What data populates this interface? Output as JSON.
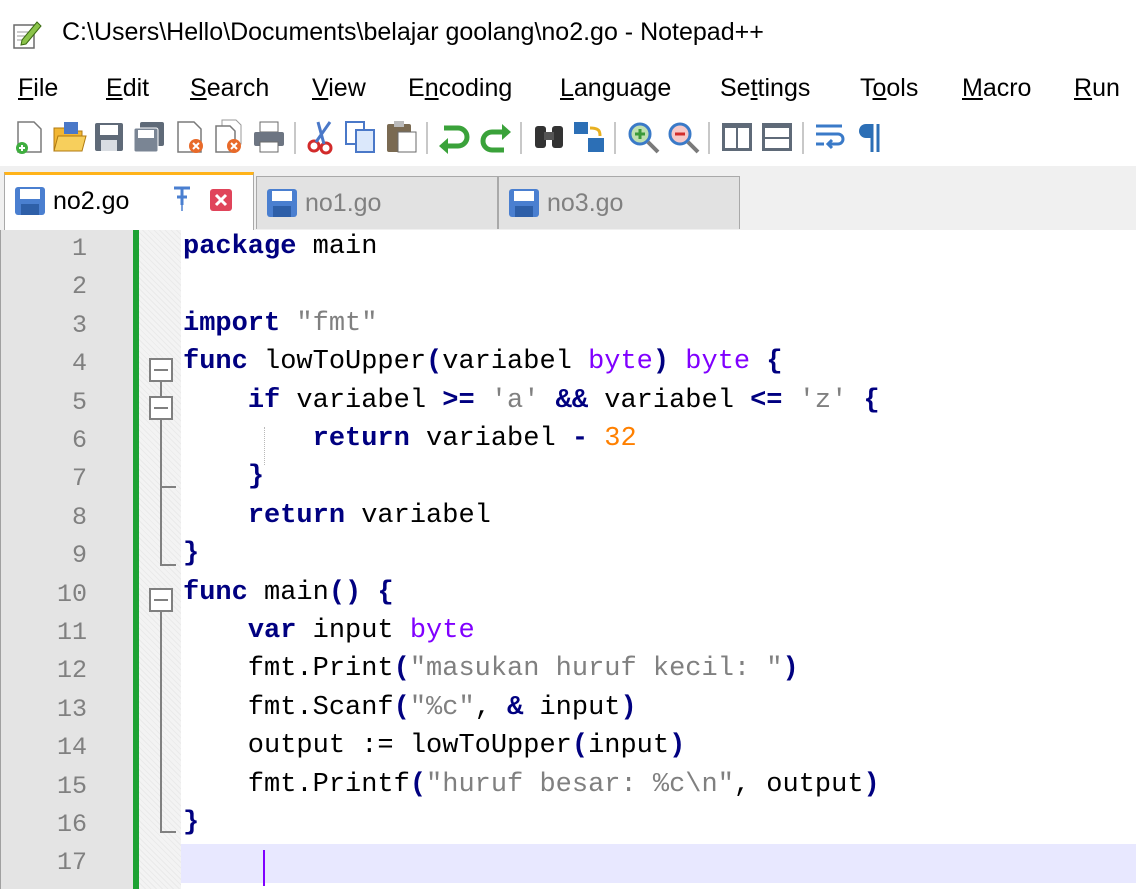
{
  "window": {
    "title": "C:\\Users\\Hello\\Documents\\belajar goolang\\no2.go - Notepad++"
  },
  "menu": [
    {
      "pre": "",
      "mn": "F",
      "post": "ile"
    },
    {
      "pre": "",
      "mn": "E",
      "post": "dit"
    },
    {
      "pre": "",
      "mn": "S",
      "post": "earch"
    },
    {
      "pre": "",
      "mn": "V",
      "post": "iew"
    },
    {
      "pre": "E",
      "mn": "n",
      "post": "coding"
    },
    {
      "pre": "",
      "mn": "L",
      "post": "anguage"
    },
    {
      "pre": "Se",
      "mn": "t",
      "post": "tings"
    },
    {
      "pre": "T",
      "mn": "o",
      "post": "ols"
    },
    {
      "pre": "",
      "mn": "M",
      "post": "acro"
    },
    {
      "pre": "",
      "mn": "R",
      "post": "un"
    }
  ],
  "toolbar_icons": [
    "new-file-icon",
    "open-file-icon",
    "save-icon",
    "save-all-icon",
    "close-icon",
    "close-all-icon",
    "print-icon",
    "cut-icon",
    "copy-icon",
    "paste-icon",
    "undo-icon",
    "redo-icon",
    "find-icon",
    "replace-icon",
    "zoom-in-icon",
    "zoom-out-icon",
    "sync-vertical-icon",
    "sync-horizontal-icon",
    "word-wrap-icon",
    "show-all-chars-icon"
  ],
  "tabs": [
    {
      "label": "no2.go",
      "active": true
    },
    {
      "label": "no1.go",
      "active": false
    },
    {
      "label": "no3.go",
      "active": false
    }
  ],
  "colors": {
    "keyword": "#000080",
    "type": "#8000ff",
    "string": "#808080",
    "number": "#ff8000",
    "change_bar": "#1da233",
    "current_line": "#e8e8ff"
  },
  "editor": {
    "lines": [
      {
        "n": "1",
        "text": "package main"
      },
      {
        "n": "2",
        "text": ""
      },
      {
        "n": "3",
        "text": "import \"fmt\""
      },
      {
        "n": "4",
        "text": "func lowToUpper(variabel byte) byte {"
      },
      {
        "n": "5",
        "text": "    if variabel >= 'a' && variabel <= 'z' {"
      },
      {
        "n": "6",
        "text": "        return variabel - 32"
      },
      {
        "n": "7",
        "text": "    }"
      },
      {
        "n": "8",
        "text": "    return variabel"
      },
      {
        "n": "9",
        "text": "}"
      },
      {
        "n": "10",
        "text": "func main() {"
      },
      {
        "n": "11",
        "text": "    var input byte"
      },
      {
        "n": "12",
        "text": "    fmt.Print(\"masukan huruf kecil: \")"
      },
      {
        "n": "13",
        "text": "    fmt.Scanf(\"%c\", & input)"
      },
      {
        "n": "14",
        "text": "    output := lowToUpper(input)"
      },
      {
        "n": "15",
        "text": "    fmt.Printf(\"huruf besar: %c\\n\", output)"
      },
      {
        "n": "16",
        "text": "}"
      },
      {
        "n": "17",
        "text": ""
      }
    ]
  }
}
